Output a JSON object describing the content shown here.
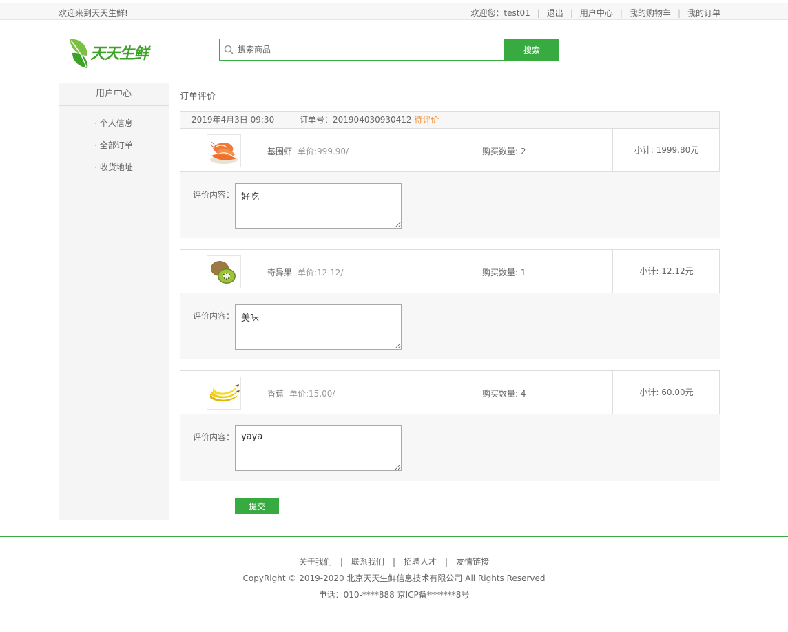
{
  "topbar": {
    "welcome": "欢迎来到天天生鲜!",
    "user_prefix": "欢迎您：",
    "username": "test01",
    "logout": "退出",
    "user_center": "用户中心",
    "cart": "我的购物车",
    "orders": "我的订单"
  },
  "header": {
    "logo_text": "天天生鲜",
    "search_placeholder": "搜索商品",
    "search_button": "搜索"
  },
  "sidebar": {
    "title": "用户中心",
    "items": [
      {
        "label": "· 个人信息"
      },
      {
        "label": "· 全部订单"
      },
      {
        "label": "· 收货地址"
      }
    ]
  },
  "main": {
    "heading": "订单评价",
    "order": {
      "date": "2019年4月3日 09:30",
      "number_label": "订单号：",
      "number": "201904030930412",
      "status": "待评价"
    },
    "review_label": "评价内容：",
    "items": [
      {
        "name": "基围虾",
        "price": "单价:999.90/",
        "qty": "购买数量: 2",
        "subtotal": "小计: 1999.80元",
        "review": "好吃",
        "image": "shrimp"
      },
      {
        "name": "奇异果",
        "price": "单价:12.12/",
        "qty": "购买数量: 1",
        "subtotal": "小计: 12.12元",
        "review": "美味",
        "image": "kiwi"
      },
      {
        "name": "香蕉",
        "price": "单价:15.00/",
        "qty": "购买数量: 4",
        "subtotal": "小计: 60.00元",
        "review": "yaya",
        "image": "banana"
      }
    ],
    "submit": "提交"
  },
  "footer": {
    "links": [
      "关于我们",
      "联系我们",
      "招聘人才",
      "友情链接"
    ],
    "separator": "|",
    "copyright": "CopyRight © 2019-2020 北京天天生鲜信息技术有限公司 All Rights Reserved",
    "contact": "电话：010-****888 京ICP备*******8号"
  },
  "colors": {
    "brand_green": "#37ab40",
    "status_orange": "#f08a24"
  }
}
